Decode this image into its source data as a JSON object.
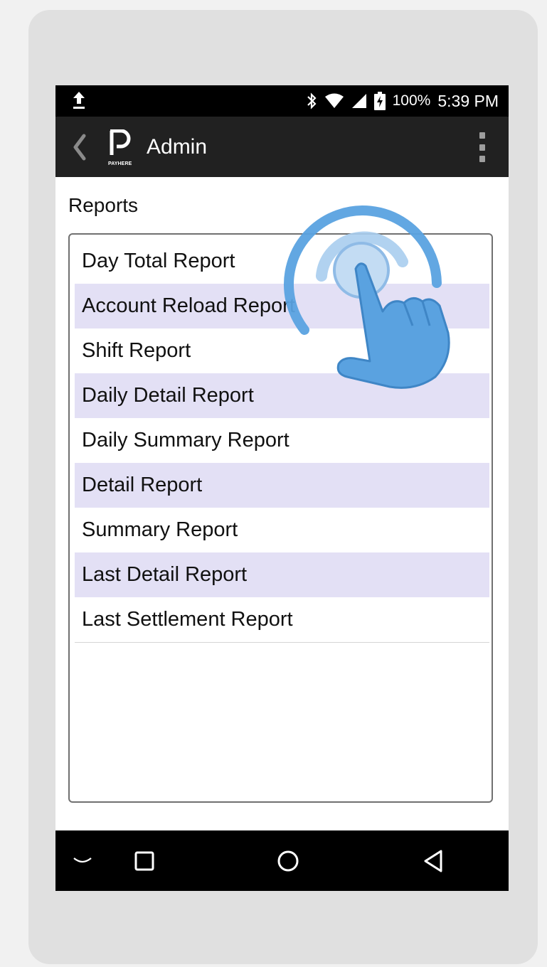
{
  "status_bar": {
    "battery_percent": "100%",
    "time": "5:39 PM",
    "icons": [
      "upload-icon",
      "bluetooth-icon",
      "wifi-icon",
      "signal-icon",
      "battery-charging-icon"
    ]
  },
  "app_bar": {
    "title": "Admin",
    "logo_caption": "PAYHERE"
  },
  "reports": {
    "section_title": "Reports",
    "items": [
      {
        "label": "Day Total Report"
      },
      {
        "label": "Account Reload Report"
      },
      {
        "label": "Shift Report"
      },
      {
        "label": "Daily Detail Report"
      },
      {
        "label": "Daily Summary Report"
      },
      {
        "label": "Detail Report"
      },
      {
        "label": "Summary Report"
      },
      {
        "label": "Last Detail Report"
      },
      {
        "label": "Last Settlement Report"
      }
    ]
  },
  "nav_bar": {
    "icons": [
      "keyboard-hide-icon",
      "recents-icon",
      "home-icon",
      "back-icon"
    ]
  },
  "colors": {
    "status_bar": "#000000",
    "app_bar": "#212121",
    "row_alt": "#e3e0f5",
    "touch_accent": "#5aa2e0"
  }
}
